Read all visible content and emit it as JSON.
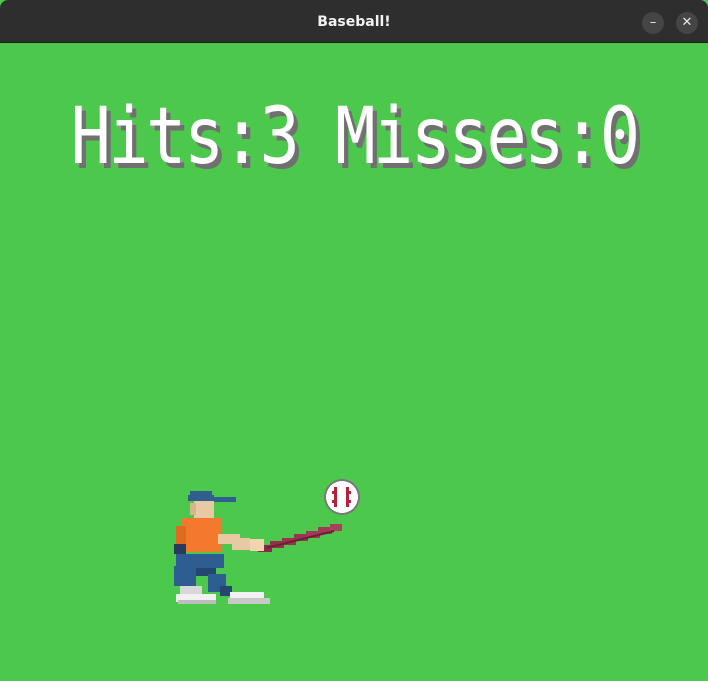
{
  "window": {
    "title": "Baseball!",
    "minimize_symbol": "–",
    "close_symbol": "✕"
  },
  "hud": {
    "hits_label": "Hits:",
    "hits": "3",
    "misses_label": " Misses:",
    "misses": "0"
  },
  "scene": {
    "background_color": "#4cc84c",
    "batter": "batter-sprite",
    "ball": "baseball-sprite"
  }
}
